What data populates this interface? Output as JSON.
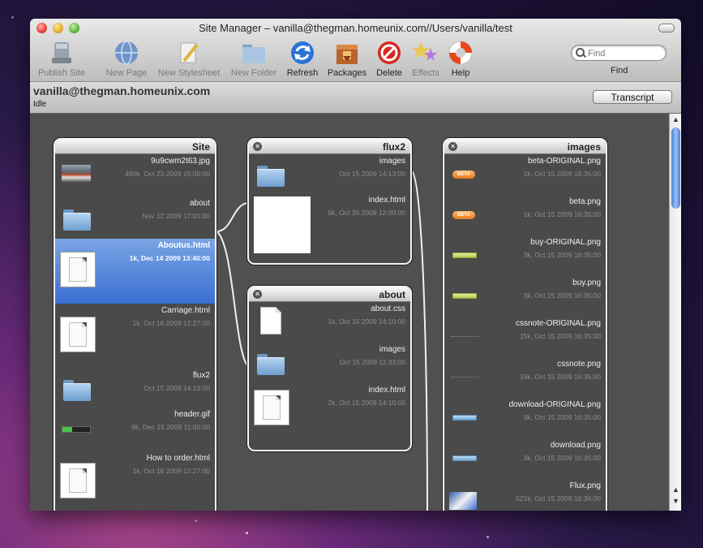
{
  "window": {
    "title": "Site Manager – vanilla@thegman.homeunix.com//Users/vanilla/test"
  },
  "toolbar": {
    "items": [
      {
        "label": "Publish Site",
        "icon": "server-icon",
        "enabled": false
      },
      {
        "label": "New Page",
        "icon": "globe-icon",
        "enabled": false
      },
      {
        "label": "New Stylesheet",
        "icon": "pencil-icon",
        "enabled": false
      },
      {
        "label": "New Folder",
        "icon": "folder-icon",
        "enabled": false
      },
      {
        "label": "Refresh",
        "icon": "refresh-icon",
        "enabled": true
      },
      {
        "label": "Packages",
        "icon": "package-icon",
        "enabled": true
      },
      {
        "label": "Delete",
        "icon": "delete-icon",
        "enabled": true
      },
      {
        "label": "Effects",
        "icon": "stars-icon",
        "enabled": false
      },
      {
        "label": "Help",
        "icon": "lifebuoy-icon",
        "enabled": true
      }
    ],
    "search": {
      "placeholder": "Find",
      "value": "",
      "label": "Find"
    }
  },
  "status": {
    "host": "vanilla@thegman.homeunix.com",
    "state": "Idle",
    "transcript_label": "Transcript"
  },
  "columns": {
    "site": {
      "title": "Site",
      "items": [
        {
          "name": "9u9cwm2t63.jpg",
          "meta": "490k, Oct 23 2009 15:00:00",
          "kind": "image"
        },
        {
          "name": "about",
          "meta": "Nov 12 2009 17:01:00",
          "kind": "folder"
        },
        {
          "name": "Aboutus.html",
          "meta": "1k, Dec 14 2009 13:40:00",
          "kind": "doc",
          "selected": true
        },
        {
          "name": "Carriage.html",
          "meta": "1k, Oct 16 2009 12:27:00",
          "kind": "doc"
        },
        {
          "name": "flux2",
          "meta": "Oct 15 2009 14:13:00",
          "kind": "folder"
        },
        {
          "name": "header.gif",
          "meta": "6k, Dec 15 2009 11:00:00",
          "kind": "gauge"
        },
        {
          "name": "How to order.html",
          "meta": "1k, Oct 16 2009 12:27:00",
          "kind": "doc"
        }
      ]
    },
    "flux2": {
      "title": "flux2",
      "items": [
        {
          "name": "images",
          "meta": "Oct 15 2009 14:13:00",
          "kind": "folder"
        },
        {
          "name": "index.html",
          "meta": "9k, Oct 20 2009 12:00:00",
          "kind": "white"
        }
      ]
    },
    "about": {
      "title": "about",
      "items": [
        {
          "name": "about.css",
          "meta": "1k, Oct 15 2009 14:10:00",
          "kind": "sheet"
        },
        {
          "name": "images",
          "meta": "Oct 15 2009 11:33:00",
          "kind": "folder"
        },
        {
          "name": "index.html",
          "meta": "2k, Oct 15 2009 14:10:00",
          "kind": "doc"
        }
      ]
    },
    "images": {
      "title": "images",
      "items": [
        {
          "name": "beta-ORIGINAL.png",
          "meta": "1k, Oct 15 2009 16:35:00",
          "kind": "beta"
        },
        {
          "name": "beta.png",
          "meta": "1k, Oct 15 2009 16:35:00",
          "kind": "beta"
        },
        {
          "name": "buy-ORIGINAL.png",
          "meta": "3k, Oct 15 2009 16:35:00",
          "kind": "yellow"
        },
        {
          "name": "buy.png",
          "meta": "3k, Oct 15 2009 16:35:00",
          "kind": "yellow"
        },
        {
          "name": "cssnote-ORIGINAL.png",
          "meta": "15k, Oct 15 2009 16:35:00",
          "kind": "dots"
        },
        {
          "name": "cssnote.png",
          "meta": "15k, Oct 15 2009 16:35:00",
          "kind": "dots"
        },
        {
          "name": "download-ORIGINAL.png",
          "meta": "3k, Oct 15 2009 16:35:00",
          "kind": "blue"
        },
        {
          "name": "download.png",
          "meta": "3k, Oct 15 2009 16:35:00",
          "kind": "blue"
        },
        {
          "name": "Flux.png",
          "meta": "521k, Oct 15 2009 16:36:00",
          "kind": "flux"
        }
      ]
    }
  }
}
